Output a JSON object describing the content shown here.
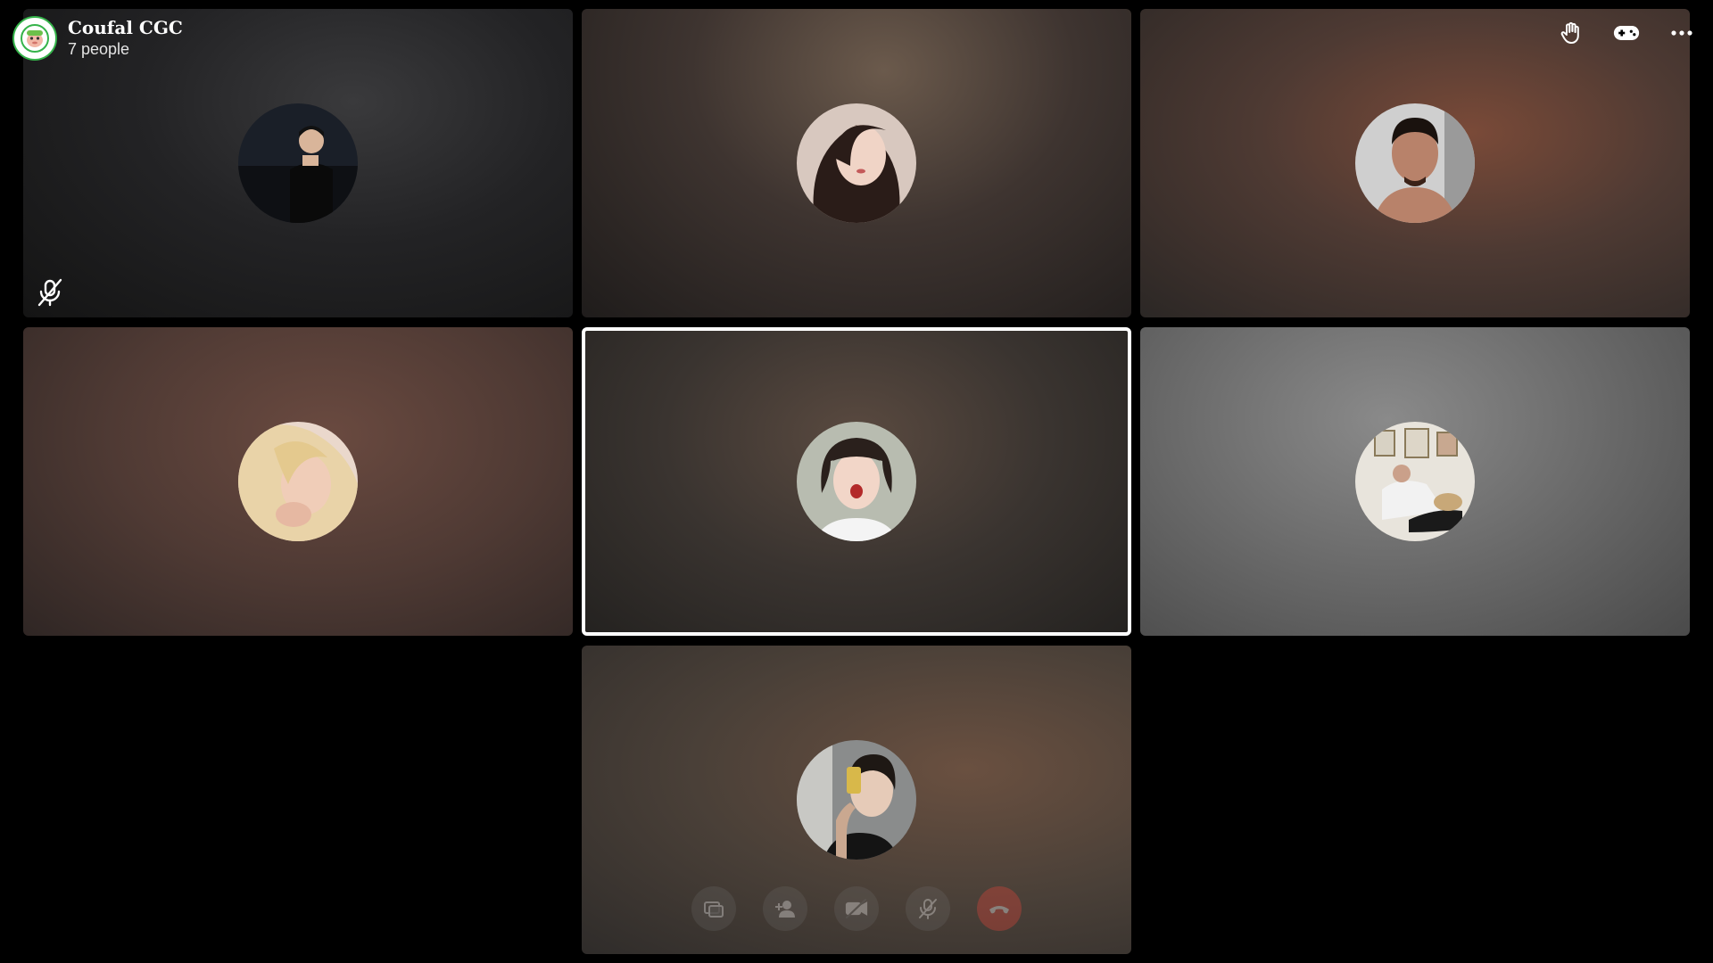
{
  "group": {
    "name": "Coufal CGC",
    "member_count_label": "7 people"
  },
  "top_actions": [
    {
      "name": "raise-hand",
      "icon": "raise-hand-icon"
    },
    {
      "name": "games",
      "icon": "gamepad-icon"
    },
    {
      "name": "more-options",
      "icon": "more-icon"
    }
  ],
  "participants": [
    {
      "tile": 1,
      "muted": true,
      "active_speaker": false
    },
    {
      "tile": 2,
      "muted": false,
      "active_speaker": false
    },
    {
      "tile": 3,
      "muted": false,
      "active_speaker": false
    },
    {
      "tile": 4,
      "muted": false,
      "active_speaker": false
    },
    {
      "tile": 5,
      "muted": false,
      "active_speaker": true
    },
    {
      "tile": 6,
      "muted": false,
      "active_speaker": false
    },
    {
      "tile": 7,
      "muted": false,
      "active_speaker": false
    }
  ],
  "controls": [
    {
      "name": "share-screen",
      "icon": "share-screen-icon"
    },
    {
      "name": "add-people",
      "icon": "add-person-icon"
    },
    {
      "name": "camera-off",
      "icon": "camera-off-icon"
    },
    {
      "name": "mic-off",
      "icon": "mic-off-icon"
    },
    {
      "name": "end-call",
      "icon": "end-call-icon",
      "color": "#e0453a"
    }
  ],
  "colors": {
    "background": "#000000",
    "active_border": "#ffffff",
    "end_call": "#e0453a",
    "group_avatar_ring": "#35b34a"
  }
}
